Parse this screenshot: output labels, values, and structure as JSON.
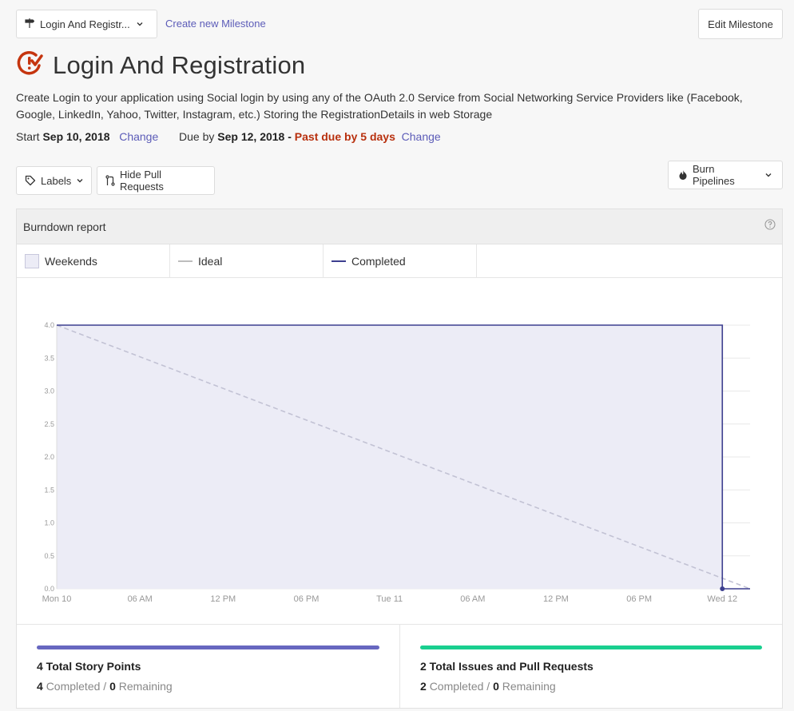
{
  "toolbar": {
    "milestone_select": "Login And Registr...",
    "create_link": "Create new Milestone",
    "edit_button": "Edit Milestone"
  },
  "milestone": {
    "title": "Login And Registration",
    "description": "Create Login to your application using Social login by using any of the OAuth 2.0 Service from Social Networking Service Providers like (Facebook, Google, LinkedIn, Yahoo, Twitter, Instagram, etc.) Storing the RegistrationDetails in web Storage",
    "start_label": "Start",
    "start_date": "Sep 10, 2018",
    "start_change": "Change",
    "due_label": "Due by",
    "due_date": "Sep 12, 2018",
    "due_separator": "-",
    "past_due": "Past due by 5 days",
    "due_change": "Change"
  },
  "filters": {
    "labels": "Labels",
    "hide_prs": "Hide Pull Requests",
    "burn_pipelines": "Burn Pipelines"
  },
  "report": {
    "title": "Burndown report",
    "legend": [
      "Weekends",
      "Ideal",
      "Completed"
    ]
  },
  "colors": {
    "accent": "#5c5cb8",
    "milestone_icon": "#c5350f",
    "past_due": "#b8300e",
    "completed_line": "#3d3f8f",
    "ideal_line": "#c2c2d4",
    "weekend_fill": "#ececf6",
    "story_bar": "#6767c0",
    "issues_bar": "#19cf8f"
  },
  "chart_data": {
    "type": "line",
    "x_ticks": [
      "Mon 10",
      "06 AM",
      "12 PM",
      "06 PM",
      "Tue 11",
      "06 AM",
      "12 PM",
      "06 PM",
      "Wed 12"
    ],
    "y_ticks": [
      "0.0",
      "0.5",
      "1.0",
      "1.5",
      "2.0",
      "2.5",
      "3.0",
      "3.5",
      "4.0"
    ],
    "ylim": [
      0,
      4
    ],
    "xlim_hours": [
      0,
      50
    ],
    "series": [
      {
        "name": "Ideal",
        "style": "dashed",
        "points": [
          [
            0,
            4
          ],
          [
            50,
            0
          ]
        ]
      },
      {
        "name": "Completed",
        "style": "step",
        "points": [
          [
            0,
            4
          ],
          [
            48,
            4
          ],
          [
            48,
            0
          ],
          [
            50,
            0
          ]
        ]
      }
    ],
    "shaded_region": {
      "series": "Weekends",
      "x_range": [
        0,
        48
      ]
    },
    "grid": true
  },
  "stats": {
    "story_points": {
      "title": "4 Total Story Points",
      "completed": "4",
      "completed_label": "Completed",
      "sep": "/",
      "remaining": "0",
      "remaining_label": "Remaining",
      "progress": 1.0
    },
    "issues": {
      "title": "2 Total Issues and Pull Requests",
      "completed": "2",
      "completed_label": "Completed",
      "sep": "/",
      "remaining": "0",
      "remaining_label": "Remaining",
      "progress": 1.0
    }
  }
}
